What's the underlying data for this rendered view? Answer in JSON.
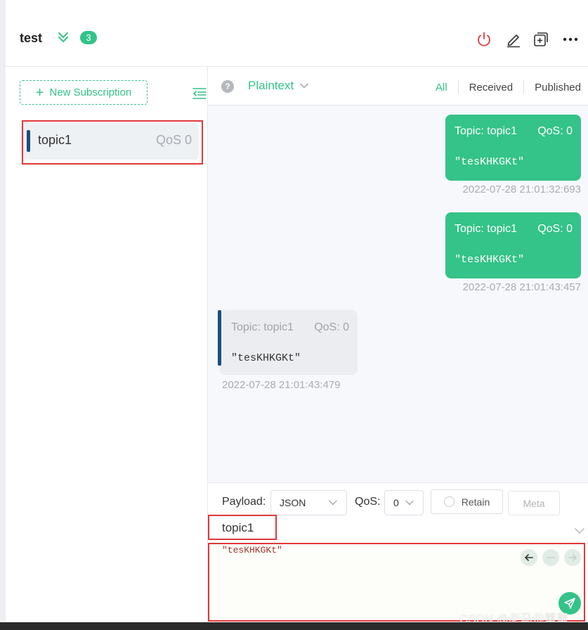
{
  "connection": {
    "name": "test",
    "count": "3"
  },
  "sidebar": {
    "new_subscription_label": "New Subscription",
    "subscriptions": [
      {
        "topic": "topic1",
        "qos": "QoS 0",
        "color": "#1a4f82"
      }
    ]
  },
  "filter": {
    "format": "Plaintext",
    "tabs": {
      "all": "All",
      "received": "Received",
      "published": "Published"
    }
  },
  "messages": [
    {
      "direction": "out",
      "topic": "Topic: topic1",
      "qos": "QoS: 0",
      "payload": "\"tesKHKGKt\"",
      "time": "2022-07-28 21:01:32:693"
    },
    {
      "direction": "out",
      "topic": "Topic: topic1",
      "qos": "QoS: 0",
      "payload": "\"tesKHKGKt\"",
      "time": "2022-07-28 21:01:43:457"
    },
    {
      "direction": "in",
      "topic": "Topic: topic1",
      "qos": "QoS: 0",
      "payload": "\"tesKHKGKt\"",
      "time": "2022-07-28 21:01:43:479"
    }
  ],
  "publish": {
    "payload_label": "Payload:",
    "payload_format": "JSON",
    "qos_label": "QoS:",
    "qos_value": "0",
    "retain_label": "Retain",
    "meta_label": "Meta",
    "topic": "topic1",
    "payload": "\"tesKHKGKt\""
  },
  "watermark": "CSDN @老马他舅舅",
  "colors": {
    "accent": "#34c388",
    "received_bar": "#1a4f82",
    "disconnect": "#e0393a"
  }
}
